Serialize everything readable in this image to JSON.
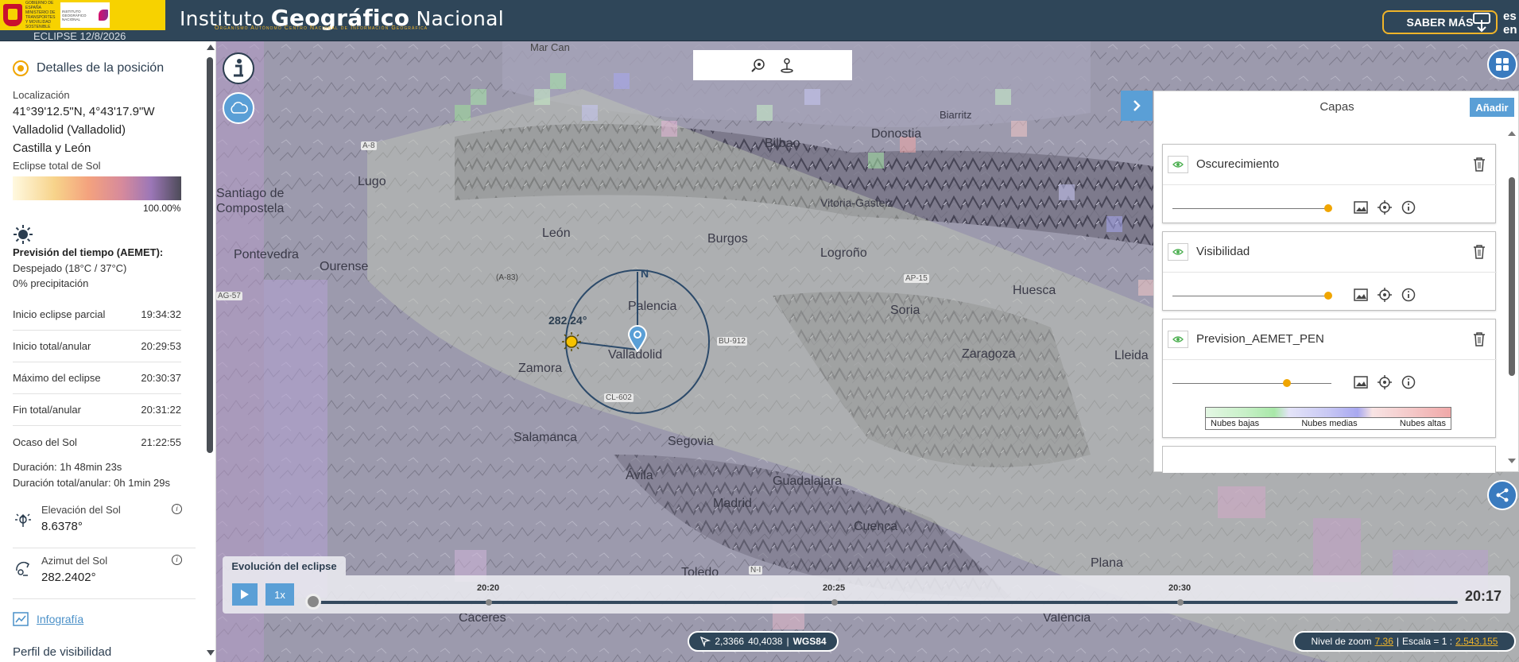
{
  "header": {
    "ministry_text": "GOBIERNO DE ESPAÑA",
    "ministry_sub": "MINISTERIO DE TRANSPORTES Y MOVILIDAD SOSTENIBLE",
    "agency_text": "INSTITUTO GEOGRÁFICO NACIONAL",
    "title_part1": "Instituto ",
    "title_part2": "Geográfico",
    "title_part3": " Nacional",
    "subtitle": "Organismo Autónomo Centro Nacional de Información Geográfica",
    "eclipse_label": "ECLIPSE 12/8/2026",
    "saber_mas": "SABER MÁS",
    "lang_es": "es",
    "lang_en": "en"
  },
  "sidebar": {
    "title": "Detalles de la posición",
    "localizacion_label": "Localización",
    "coords": "41°39'12.5\"N, 4°43'17.9\"W",
    "city": "Valladolid (Valladolid)",
    "region": "Castilla y León",
    "eclipse_type": "Eclipse total de Sol",
    "obscuration": "100.00%",
    "weather_title": "Previsión del tiempo (AEMET):",
    "weather_desc": "Despejado (18°C / 37°C)",
    "weather_precip": "0% precipitación",
    "times": [
      {
        "label": "Inicio eclipse parcial",
        "value": "19:34:32"
      },
      {
        "label": "Inicio total/anular",
        "value": "20:29:53"
      },
      {
        "label": "Máximo del eclipse",
        "value": "20:30:37"
      },
      {
        "label": "Fin total/anular",
        "value": "20:31:22"
      },
      {
        "label": "Ocaso del Sol",
        "value": "21:22:55"
      }
    ],
    "duration": "Duración: 1h 48min 23s",
    "duration_total": "Duración total/anular: 0h 1min 29s",
    "elevation_label": "Elevación del Sol",
    "elevation_value": "8.6378°",
    "azimuth_label": "Azimut del Sol",
    "azimuth_value": "282.2402°",
    "info_i": "i",
    "infografia": "Infografía",
    "perfil": "Perfil de visibilidad"
  },
  "map": {
    "sea_label": "Mar Can",
    "cities": [
      {
        "name": "Lugo"
      },
      {
        "name": "Santiago de Compostela"
      },
      {
        "name": "Pontevedra"
      },
      {
        "name": "Ourense"
      },
      {
        "name": "León"
      },
      {
        "name": "Burgos"
      },
      {
        "name": "Palencia"
      },
      {
        "name": "Valladolid"
      },
      {
        "name": "Zamora"
      },
      {
        "name": "Salamanca"
      },
      {
        "name": "Segovia"
      },
      {
        "name": "Ávila"
      },
      {
        "name": "Madrid"
      },
      {
        "name": "Guadalajara"
      },
      {
        "name": "Logroño"
      },
      {
        "name": "Vitoria-Gasteiz"
      },
      {
        "name": "Donostia"
      },
      {
        "name": "Bilbao"
      },
      {
        "name": "Biarritz"
      },
      {
        "name": "Huesca"
      },
      {
        "name": "Zaragoza"
      },
      {
        "name": "Lleida"
      },
      {
        "name": "Toledo"
      },
      {
        "name": "Cuenca"
      },
      {
        "name": "Cáceres"
      },
      {
        "name": "València"
      },
      {
        "name": "Plana"
      },
      {
        "name": "Soria"
      }
    ],
    "roads": [
      "A-8",
      "AG-57",
      "(A-83)",
      "BU-912",
      "CL-602",
      "AP-15",
      "N-I"
    ],
    "compass_n": "N",
    "sun_azimuth": "282.24°"
  },
  "layers": {
    "title": "Capas",
    "add_label": "Añadir",
    "items": [
      {
        "name": "Oscurecimiento",
        "opacity": 0.98
      },
      {
        "name": "Visibilidad",
        "opacity": 0.98
      },
      {
        "name": "Prevision_AEMET_PEN",
        "opacity": 0.72
      }
    ],
    "legend": [
      "Nubes bajas",
      "Nubes medias",
      "Nubes altas"
    ]
  },
  "timeline": {
    "title": "Evolución del eclipse",
    "speed": "1x",
    "ticks": [
      "20:20",
      "20:25",
      "20:30"
    ],
    "current": "20:17",
    "progress": 0.0
  },
  "status": {
    "x": "2,3366",
    "y": "40,4038",
    "crs": "WGS84",
    "zoom_label": "Nivel de zoom",
    "zoom_value": "7.36",
    "scale_label": "Escala = 1 :",
    "scale_value": "2.543.155"
  }
}
